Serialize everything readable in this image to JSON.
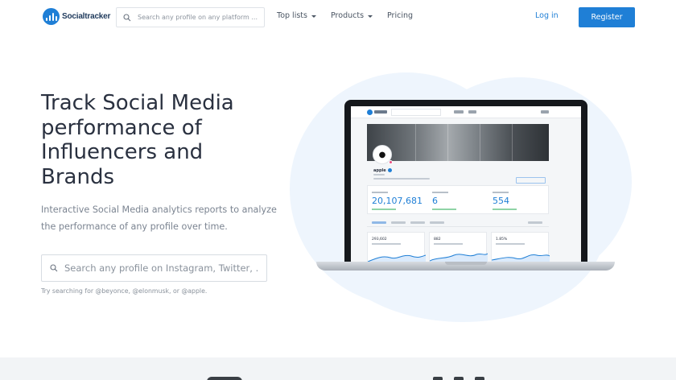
{
  "brand": {
    "name": "Socialtracker",
    "accent": "#1f7fd6"
  },
  "nav": {
    "search_placeholder": "Search any profile on any platform ...",
    "links": [
      {
        "label": "Top lists",
        "dropdown": true
      },
      {
        "label": "Products",
        "dropdown": true
      },
      {
        "label": "Pricing",
        "dropdown": false
      }
    ],
    "login": "Log in",
    "register": "Register"
  },
  "hero": {
    "title": "Track Social Media performance of Influencers and Brands",
    "description": "Interactive Social Media analytics reports to analyze the performance of any profile over time.",
    "search_placeholder": "Search any profile on Instagram, Twitter, ...",
    "hint": "Try searching for @beyonce, @elonmusk, or @apple."
  },
  "mockup": {
    "profile_name": "apple",
    "avatar_icon": "apple-logo-icon",
    "stats": [
      "20,107,681",
      "6",
      "554"
    ],
    "cards": [
      "293,602",
      "882",
      "1.85%"
    ]
  }
}
